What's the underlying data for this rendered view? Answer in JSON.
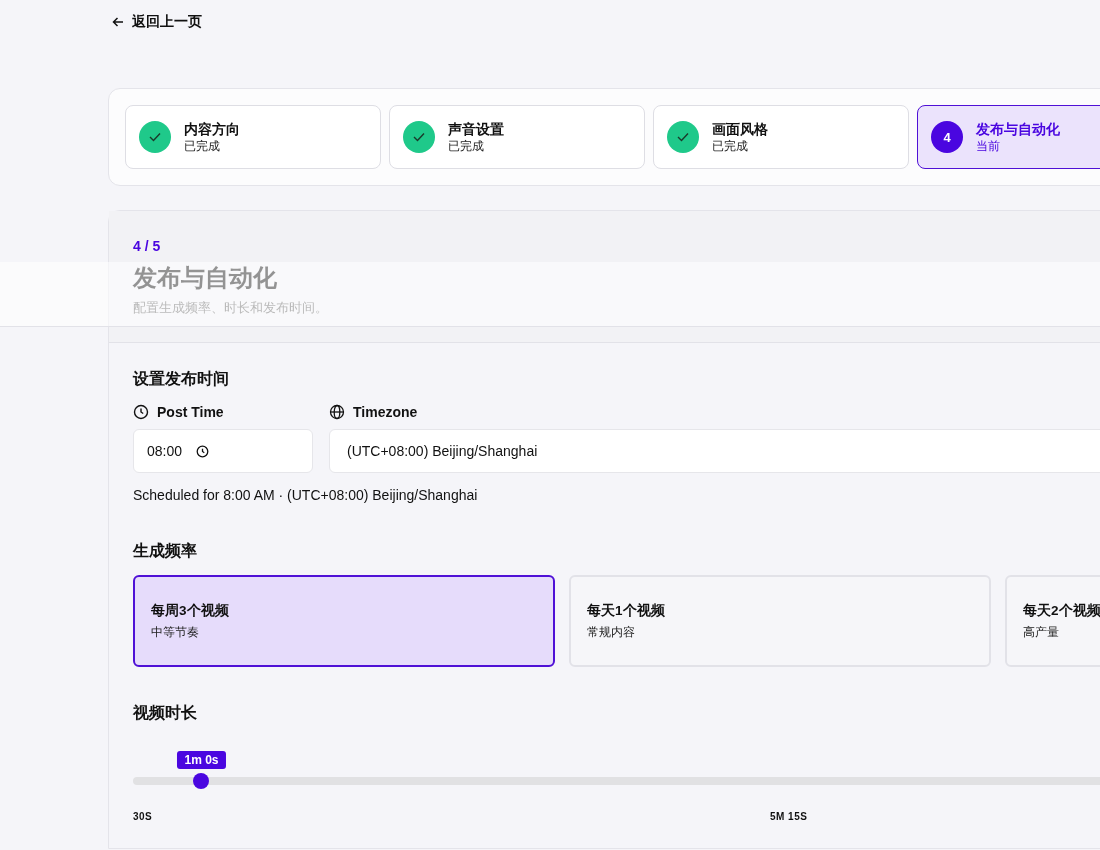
{
  "back_link": {
    "label": "返回上一页"
  },
  "steps": [
    {
      "title": "内容方向",
      "status": "已完成",
      "kind": "done",
      "selected": false
    },
    {
      "title": "声音设置",
      "status": "已完成",
      "kind": "done",
      "selected": false
    },
    {
      "title": "画面风格",
      "status": "已完成",
      "kind": "done",
      "selected": false
    },
    {
      "title": "发布与自动化",
      "status": "当前",
      "kind": "current",
      "number": "4",
      "selected": true
    }
  ],
  "header": {
    "progress": "4 / 5",
    "title": "发布与自动化",
    "subtitle": "配置生成频率、时长和发布时间。"
  },
  "schedule": {
    "heading": "设置发布时间",
    "post_time_label": "Post Time",
    "post_time_value": "08:00",
    "timezone_label": "Timezone",
    "timezone_value": "(UTC+08:00) Beijing/Shanghai",
    "summary": "Scheduled for 8:00 AM · (UTC+08:00) Beijing/Shanghai"
  },
  "frequency": {
    "heading": "生成频率",
    "options": [
      {
        "title": "每周3个视频",
        "subtitle": "中等节奏",
        "selected": true
      },
      {
        "title": "每天1个视频",
        "subtitle": "常规内容",
        "selected": false
      },
      {
        "title": "每天2个视频",
        "subtitle": "高产量",
        "selected": false
      }
    ]
  },
  "duration": {
    "heading": "视频时长",
    "tooltip": "1m 0s",
    "level": 0.053,
    "ticks": [
      "30S",
      "5M 15S"
    ]
  }
}
